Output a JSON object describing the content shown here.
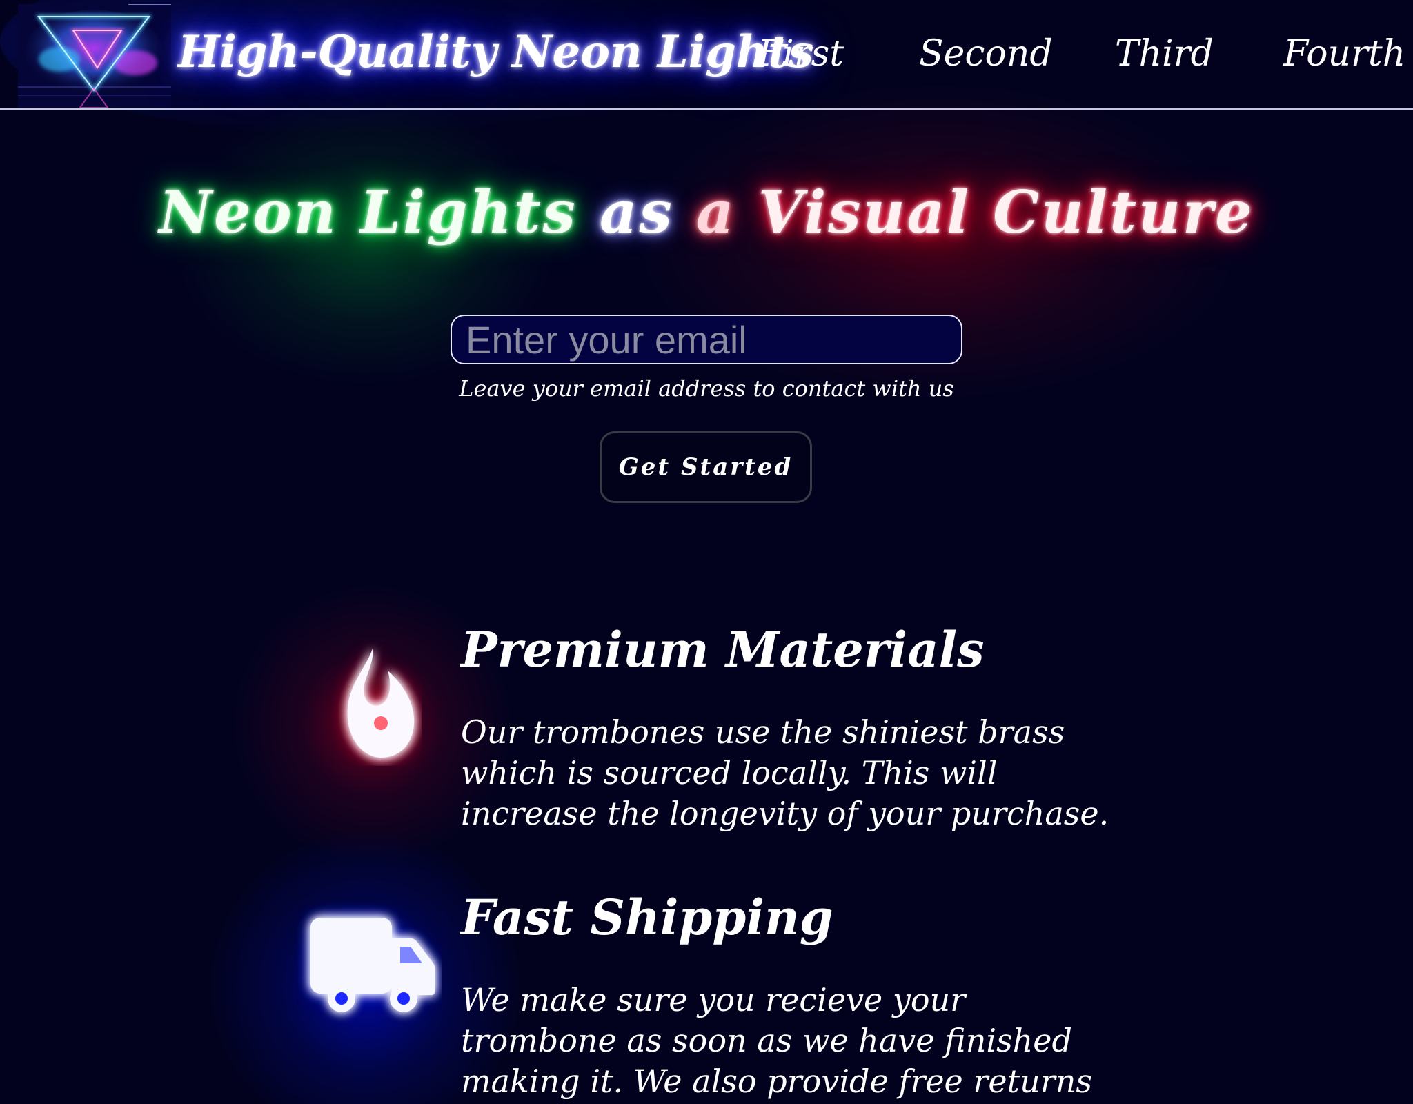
{
  "header": {
    "brand_title": "High-Quality Neon Lights",
    "nav": [
      "First",
      "Second",
      "Third",
      "Fourth"
    ],
    "logo_icon": "neon-triangle-logo"
  },
  "hero": {
    "title_words": [
      "Neon",
      "Lights",
      "as",
      "a",
      "Visual",
      "Culture"
    ],
    "email_placeholder": "Enter your email",
    "email_hint": "Leave your email address to contact with us",
    "cta_label": "Get Started"
  },
  "features": [
    {
      "icon": "fire-icon",
      "title": "Premium Materials",
      "text": "Our trombones use the shiniest brass which is sourced locally. This will increase the longevity of your purchase.",
      "glow_color": "#ff1a3a"
    },
    {
      "icon": "truck-icon",
      "title": "Fast Shipping",
      "text": "We make sure you recieve your trombone as soon as we have finished making it. We also provide free returns if you are not satisfied.",
      "glow_color": "#1a2aff"
    }
  ],
  "colors": {
    "background": "#02021f",
    "neon_green": "#22ff55",
    "neon_red": "#ff3355",
    "neon_blue": "#3b3bff",
    "neon_pink": "#ff4fd8",
    "input_bg": "#030342"
  }
}
